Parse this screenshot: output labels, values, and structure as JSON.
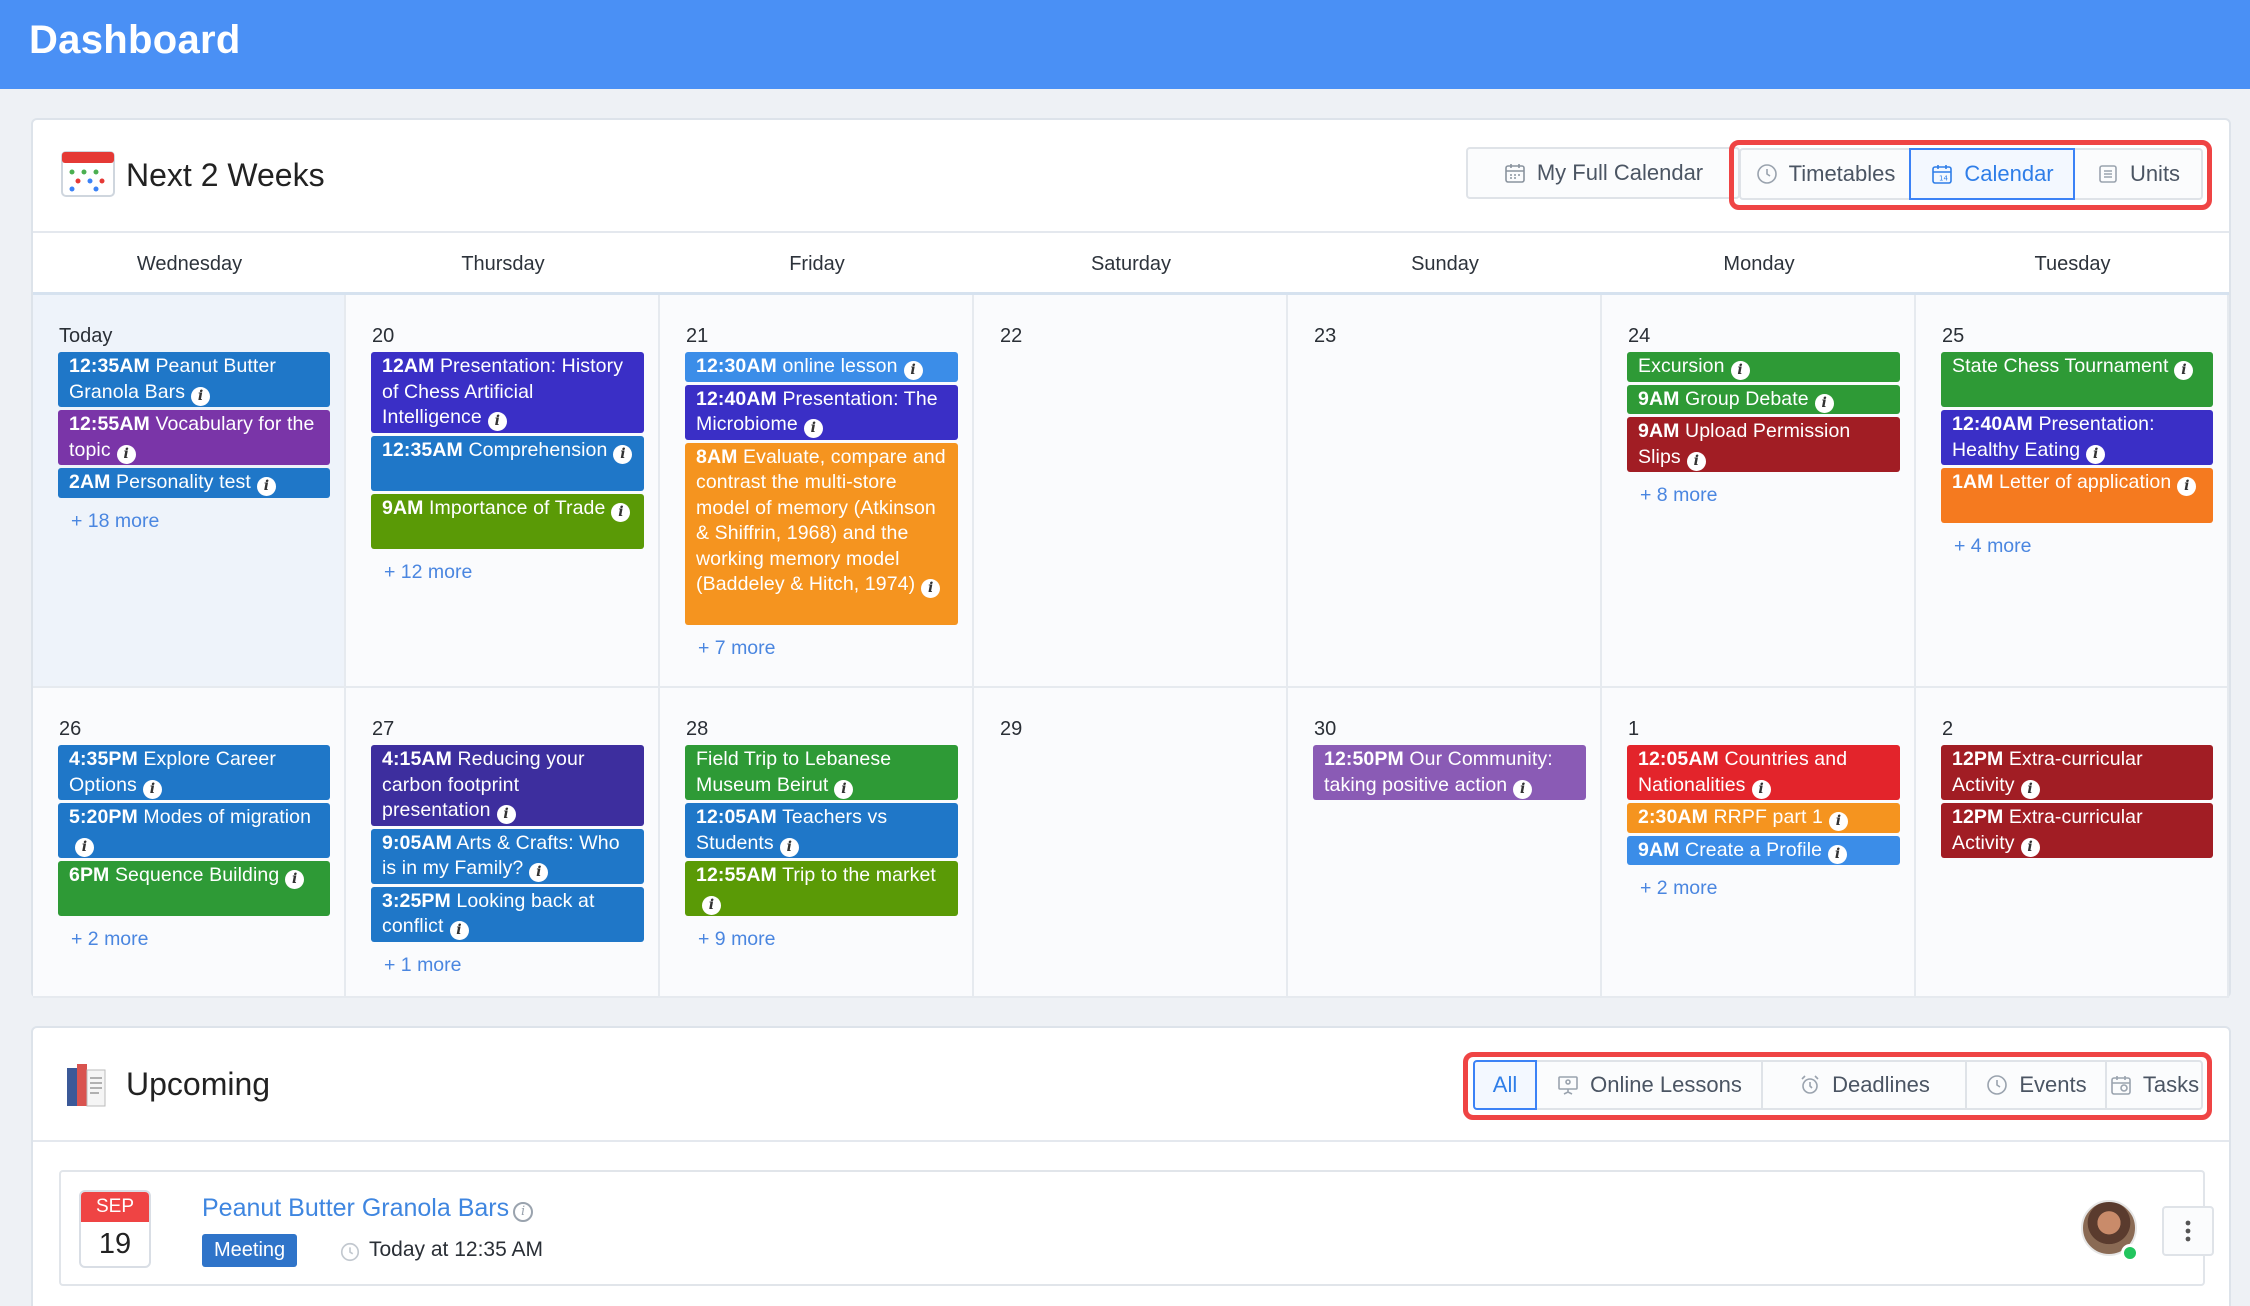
{
  "header": {
    "title": "Dashboard"
  },
  "calendar_panel": {
    "title": "Next 2 Weeks",
    "full_calendar_label": "My Full Calendar",
    "views": [
      {
        "label": "Timetables",
        "active": false,
        "icon": "clock-icon"
      },
      {
        "label": "Calendar",
        "active": true,
        "icon": "calendar-icon"
      },
      {
        "label": "Units",
        "active": false,
        "icon": "list-icon"
      }
    ],
    "weekdays": [
      "Wednesday",
      "Thursday",
      "Friday",
      "Saturday",
      "Sunday",
      "Monday",
      "Tuesday"
    ],
    "days": [
      {
        "label": "Today",
        "today": true,
        "events": [
          {
            "time": "12:35AM",
            "title": "Peanut Butter Granola Bars",
            "color": "#1f77c8"
          },
          {
            "time": "12:55AM",
            "title": "Vocabulary for the topic",
            "color": "#7a35a8"
          },
          {
            "time": "2AM",
            "title": "Personality test",
            "color": "#1f77c8"
          }
        ],
        "more": "+ 18 more"
      },
      {
        "label": "20",
        "events": [
          {
            "time": "12AM",
            "title": "Presentation: History of Chess Artificial Intelligence",
            "color": "#3a2fc6"
          },
          {
            "time": "12:35AM",
            "title": "Comprehension",
            "color": "#1f77c8"
          },
          {
            "time": "9AM",
            "title": "Importance of Trade",
            "color": "#5a9a06"
          }
        ],
        "more": "+ 12 more"
      },
      {
        "label": "21",
        "events": [
          {
            "time": "12:30AM",
            "title": "online lesson",
            "color": "#3b8de8"
          },
          {
            "time": "12:40AM",
            "title": "Presentation: The Microbiome",
            "color": "#3a2fc6"
          },
          {
            "time": "8AM",
            "title": "Evaluate, compare and contrast the multi-store model of memory (Atkinson & Shiffrin, 1968) and the working memory model (Baddeley & Hitch, 1974)",
            "color": "#f5941f"
          }
        ],
        "more": "+ 7 more"
      },
      {
        "label": "22",
        "events": [],
        "more": ""
      },
      {
        "label": "23",
        "events": [],
        "more": ""
      },
      {
        "label": "24",
        "events": [
          {
            "time": "",
            "title": "Excursion",
            "color": "#2e9a36"
          },
          {
            "time": "9AM",
            "title": "Group Debate",
            "color": "#2e9a36"
          },
          {
            "time": "9AM",
            "title": "Upload Permission Slips",
            "color": "#a11d24"
          }
        ],
        "more": "+ 8 more"
      },
      {
        "label": "25",
        "events": [
          {
            "time": "",
            "title": "State Chess Tournament",
            "color": "#2e9a36"
          },
          {
            "time": "12:40AM",
            "title": "Presentation: Healthy Eating",
            "color": "#3a2fc6"
          },
          {
            "time": "1AM",
            "title": "Letter of application",
            "color": "#f57a1f"
          }
        ],
        "more": "+ 4 more"
      },
      {
        "label": "26",
        "events": [
          {
            "time": "4:35PM",
            "title": "Explore Career Options",
            "color": "#1f77c8"
          },
          {
            "time": "5:20PM",
            "title": "Modes of migration",
            "color": "#1f77c8"
          },
          {
            "time": "6PM",
            "title": "Sequence Building",
            "color": "#2e9a36"
          }
        ],
        "more": "+ 2 more"
      },
      {
        "label": "27",
        "events": [
          {
            "time": "4:15AM",
            "title": "Reducing your carbon footprint presentation",
            "color": "#3d2e9e"
          },
          {
            "time": "9:05AM",
            "title": "Arts & Crafts: Who is in my Family?",
            "color": "#1f77c8"
          },
          {
            "time": "3:25PM",
            "title": "Looking back at conflict",
            "color": "#1f77c8"
          }
        ],
        "more": "+ 1 more"
      },
      {
        "label": "28",
        "events": [
          {
            "time": "",
            "title": "Field Trip to Lebanese Museum Beirut",
            "color": "#2e9a36"
          },
          {
            "time": "12:05AM",
            "title": "Teachers vs Students",
            "color": "#1f77c8"
          },
          {
            "time": "12:55AM",
            "title": "Trip to the market",
            "color": "#5a9a06"
          }
        ],
        "more": "+ 9 more"
      },
      {
        "label": "29",
        "events": [],
        "more": ""
      },
      {
        "label": "30",
        "events": [
          {
            "time": "12:50PM",
            "title": "Our Community: taking positive action",
            "color": "#8a5bb5"
          }
        ],
        "more": ""
      },
      {
        "label": "1",
        "events": [
          {
            "time": "12:05AM",
            "title": "Countries and Nationalities",
            "color": "#e3242b"
          },
          {
            "time": "2:30AM",
            "title": "RRPF part 1",
            "color": "#f5941f"
          },
          {
            "time": "9AM",
            "title": "Create a Profile",
            "color": "#3b8de8"
          }
        ],
        "more": "+ 2 more"
      },
      {
        "label": "2",
        "events": [
          {
            "time": "12PM",
            "title": "Extra-curricular Activity",
            "color": "#a11d24"
          },
          {
            "time": "12PM",
            "title": "Extra-curricular Activity",
            "color": "#a11d24"
          }
        ],
        "more": ""
      }
    ]
  },
  "upcoming_panel": {
    "title": "Upcoming",
    "filters": [
      {
        "label": "All",
        "active": true,
        "icon": ""
      },
      {
        "label": "Online Lessons",
        "active": false,
        "icon": "presentation-icon"
      },
      {
        "label": "Deadlines",
        "active": false,
        "icon": "alarm-icon"
      },
      {
        "label": "Events",
        "active": false,
        "icon": "clock-icon"
      },
      {
        "label": "Tasks",
        "active": false,
        "icon": "task-calendar-icon"
      }
    ],
    "item": {
      "month": "SEP",
      "day": "19",
      "title": "Peanut Butter Granola Bars",
      "tag": "Meeting",
      "time": "Today at 12:35 AM"
    }
  }
}
